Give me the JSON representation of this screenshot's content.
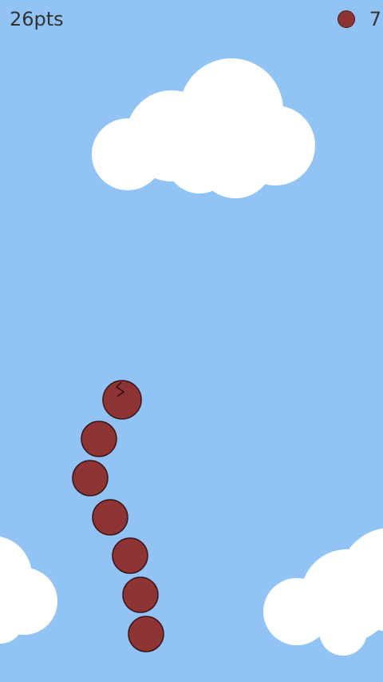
{
  "hud": {
    "score": "26pts",
    "lives": "7",
    "life_icon": "ball-icon"
  },
  "colors": {
    "sky": "#91c3f5",
    "cloud": "#ffffff",
    "ball": "#8e3434",
    "ball_outline": "#3a1515",
    "hud_text": "#333333"
  },
  "snake": {
    "segment_count": 7,
    "head_marking": "zigzag"
  },
  "clouds": [
    "top-center",
    "bottom-left",
    "bottom-right"
  ]
}
